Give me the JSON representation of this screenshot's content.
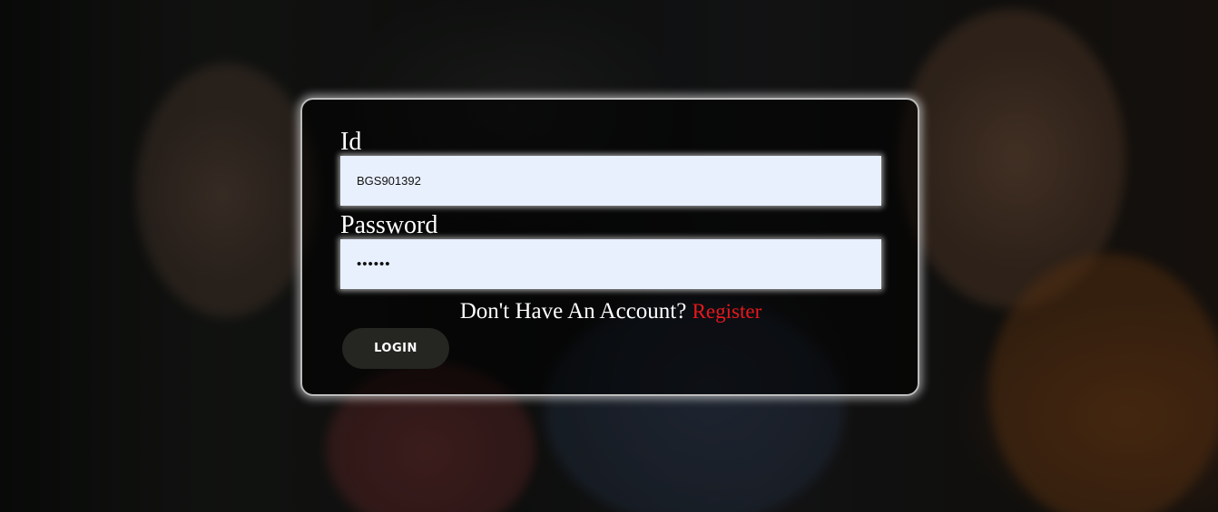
{
  "login": {
    "id_label": "Id",
    "id_value": "BGS901392",
    "password_label": "Password",
    "password_value": "passwd",
    "account_prompt": "Don't Have An Account?",
    "register_link": "Register",
    "login_button": "LOGIN"
  },
  "colors": {
    "register_link": "#e8181d",
    "input_background": "#e8f0fe",
    "button_background": "#252622"
  }
}
